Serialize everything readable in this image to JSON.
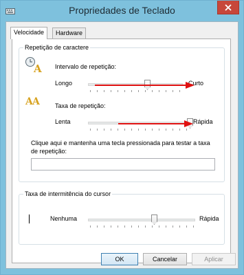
{
  "window": {
    "title": "Propriedades de Teclado"
  },
  "tabs": [
    {
      "label": "Velocidade",
      "active": true
    },
    {
      "label": "Hardware",
      "active": false
    }
  ],
  "repeat_group": {
    "legend": "Repetição de caractere",
    "delay": {
      "label": "Intervalo de repetição:",
      "left": "Longo",
      "right": "Curto",
      "value_fraction": 0.66,
      "icon": "keyboard-delay-icon"
    },
    "rate": {
      "label": "Taxa de repetição:",
      "left": "Lenta",
      "right": "Rápida",
      "value_fraction": 1.0,
      "icon": "keyboard-rate-icon"
    },
    "test": {
      "label": "Clique aqui e mantenha uma tecla pressionada para testar a taxa de repetição:",
      "value": ""
    }
  },
  "cursor_group": {
    "legend": "Taxa de intermitência do cursor",
    "left": "Nenhuma",
    "right": "Rápida",
    "value_fraction": 0.6
  },
  "buttons": {
    "ok": "OK",
    "cancel": "Cancelar",
    "apply": "Aplicar"
  },
  "colors": {
    "annotation_arrow": "#e01010",
    "titlebar": "#7ec1dd",
    "close_button": "#c7473a"
  }
}
